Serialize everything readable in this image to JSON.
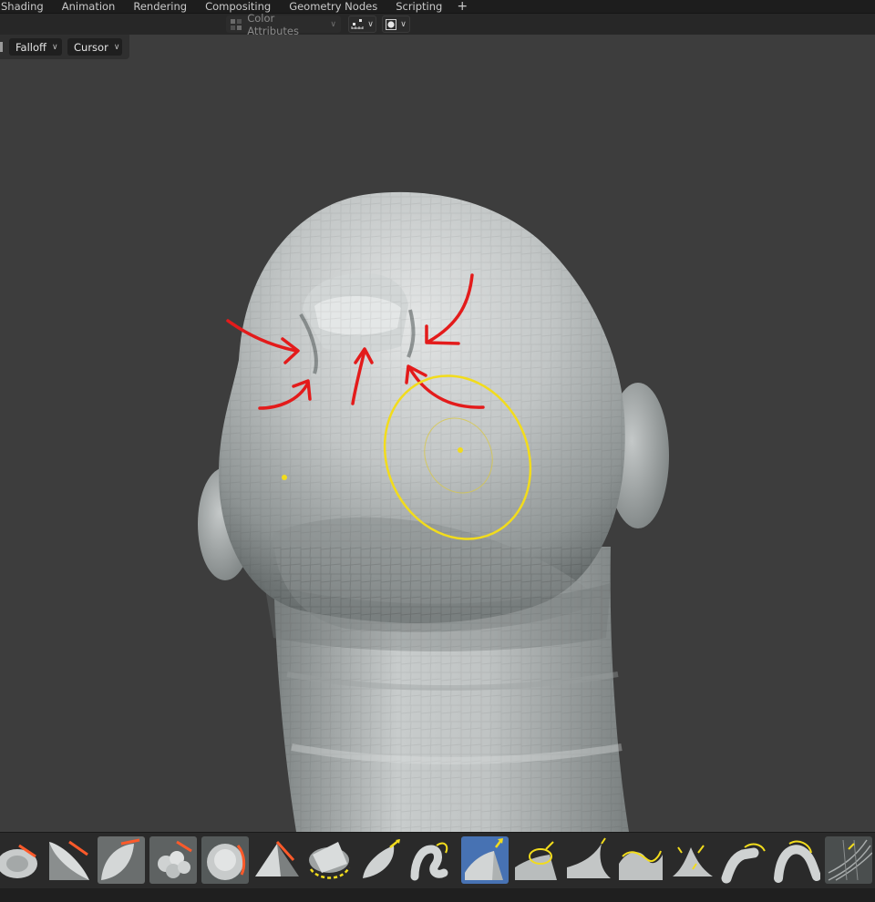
{
  "workspace_tabs": [
    "Shading",
    "Animation",
    "Rendering",
    "Compositing",
    "Geometry Nodes",
    "Scripting"
  ],
  "add_workspace_symbol": "+",
  "header": {
    "color_attributes_label": "Color Attributes",
    "sculpt_mode_icon": "sculpt-mode-icon",
    "display_icon": "mesh-display-icon",
    "shading_icon": "viewport-shading-icon"
  },
  "tool_header": {
    "falloff_label": "Falloff",
    "cursor_label": "Cursor"
  },
  "colors": {
    "annotation_red": "#e31b1b",
    "brush_cursor_yellow": "#f2dc1c",
    "active_brush_blue": "#4772b3",
    "brush_accent_orange": "#ff5a2a"
  },
  "brushes": [
    {
      "name": "draw-brush-icon",
      "active": false
    },
    {
      "name": "draw-sharp-brush-icon",
      "active": false
    },
    {
      "name": "clay-brush-icon",
      "active": false
    },
    {
      "name": "clay-strips-brush-icon",
      "active": false
    },
    {
      "name": "clay-thumb-brush-icon",
      "active": false
    },
    {
      "name": "layer-brush-icon",
      "active": false
    },
    {
      "name": "inflate-brush-icon",
      "active": false
    },
    {
      "name": "blob-brush-icon",
      "active": false
    },
    {
      "name": "crease-brush-icon",
      "active": false
    },
    {
      "name": "smooth-brush-icon",
      "active": true
    },
    {
      "name": "flatten-brush-icon",
      "active": false
    },
    {
      "name": "fill-brush-icon",
      "active": false
    },
    {
      "name": "scrape-brush-icon",
      "active": false
    },
    {
      "name": "multiplane-scrape-brush-icon",
      "active": false
    },
    {
      "name": "pinch-brush-icon",
      "active": false
    },
    {
      "name": "grab-brush-icon",
      "active": false
    },
    {
      "name": "elastic-deform-brush-icon",
      "active": false
    }
  ]
}
